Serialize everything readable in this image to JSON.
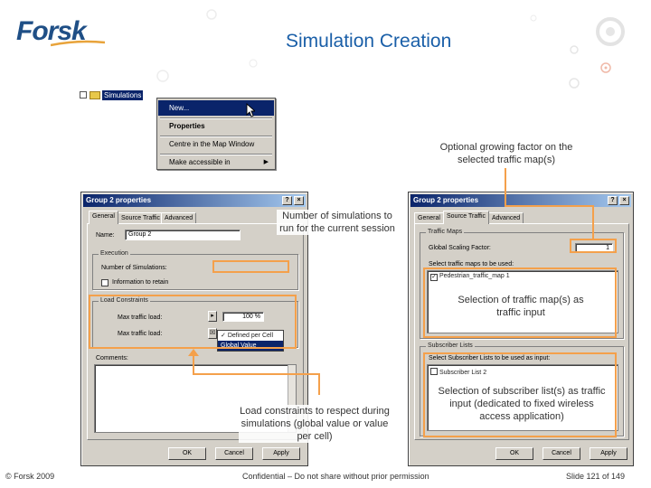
{
  "header": {
    "logo_text": "Forsk",
    "title": "Simulation Creation"
  },
  "context_menu": {
    "tree_label": "Simulations",
    "items": [
      {
        "label": "New..."
      },
      {
        "label": "Properties"
      },
      {
        "label": "Centre in the Map Window"
      },
      {
        "label": "Make accessible in"
      }
    ]
  },
  "dialog_left": {
    "title": "Group 2 properties",
    "tabs": [
      "General",
      "Source Traffic",
      "Advanced"
    ],
    "name_label": "Name:",
    "name_value": "Group 2",
    "execution_group": "Execution",
    "num_simulations_label": "Number of Simulations:",
    "info_checkbox_label": "Information to retain",
    "load_constraints_group": "Load Constraints",
    "max_traffic_load_label": "Max traffic load:",
    "max_traffic_load_value": "100 %",
    "traffic_load_label": "Max traffic load:",
    "dropdown_options": [
      "Defined per Cell",
      "Global Value"
    ],
    "comments_label": "Comments:",
    "buttons": [
      "OK",
      "Cancel",
      "Apply"
    ]
  },
  "dialog_right": {
    "title": "Group 2 properties",
    "tabs": [
      "General",
      "Source Traffic",
      "Advanced"
    ],
    "traffic_maps_group": "Traffic Maps",
    "scaling_factor_label": "Global Scaling Factor:",
    "scaling_factor_value": "1",
    "select_maps_label": "Select traffic maps to be used:",
    "map_item": "Pedestrian_traffic_map 1",
    "subscriber_group": "Subscriber Lists",
    "select_lists_label": "Select Subscriber Lists to be used as input:",
    "list_item": "Subscriber List 2",
    "buttons": [
      "OK",
      "Cancel",
      "Apply"
    ]
  },
  "annotations": {
    "growing_factor": "Optional growing factor on the selected traffic map(s)",
    "num_simulations": "Number of simulations to run for the current session",
    "traffic_map_input": "Selection of traffic map(s) as traffic input",
    "load_constraints": "Load constraints to respect during simulations (global value or value per cell)",
    "subscriber_lists": "Selection of subscriber list(s) as traffic input (dedicated to fixed wireless access application)"
  },
  "footer": {
    "left": "© Forsk 2009",
    "center": "Confidential – Do not share without prior permission",
    "right": "Slide 121 of 149"
  },
  "colors": {
    "title_blue": "#1a5fa8",
    "highlight_orange": "#f4a04b",
    "logo_blue": "#1f4f86",
    "win_gray": "#d4d0c8"
  }
}
